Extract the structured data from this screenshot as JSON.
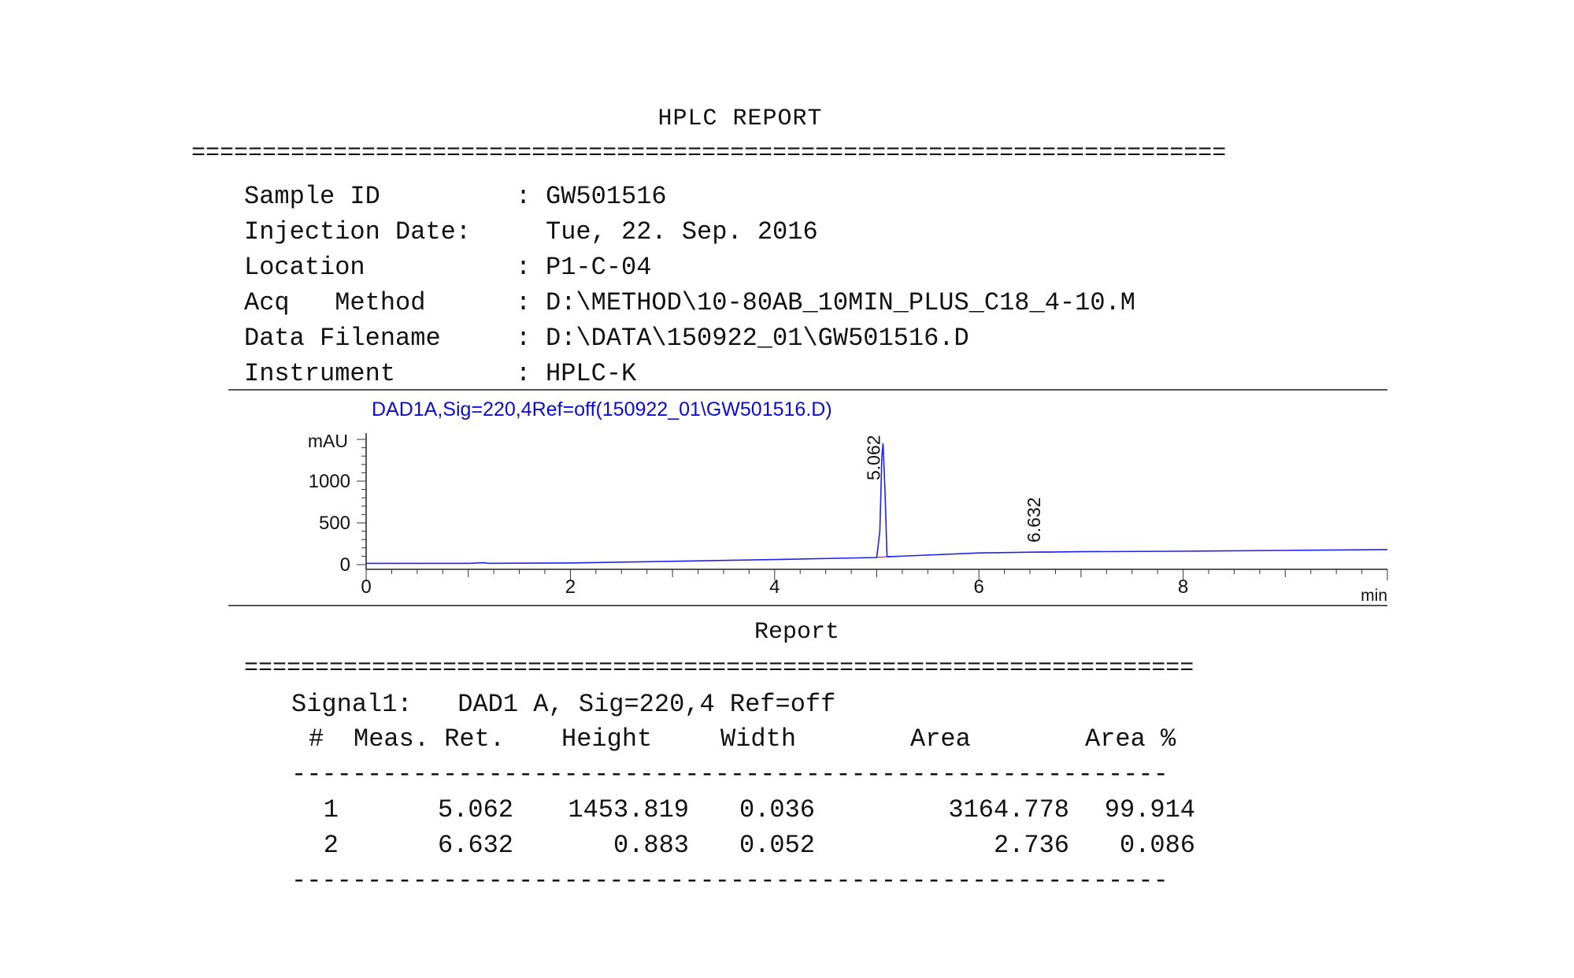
{
  "title": "HPLC REPORT",
  "rule_top": "=========================================================================",
  "meta": [
    {
      "label": "Sample ID",
      "colon": ":",
      "value": "GW501516"
    },
    {
      "label": "Injection Date:",
      "colon": "",
      "value": "Tue, 22. Sep. 2016"
    },
    {
      "label": "Location",
      "colon": ":",
      "value": "P1-C-04"
    },
    {
      "label": "Acq   Method",
      "colon": ":",
      "value": "D:\\METHOD\\10-80AB_10MIN_PLUS_C18_4-10.M"
    },
    {
      "label": "Data Filename",
      "colon": ":",
      "value": "D:\\DATA\\150922_01\\GW501516.D"
    },
    {
      "label": "Instrument",
      "colon": ":",
      "value": "HPLC-K"
    }
  ],
  "chart_data": {
    "type": "line",
    "title": "DAD1A,Sig=220,4Ref=off(150922_01\\GW501516.D)",
    "ylabel": "mAU",
    "xlabel": "min",
    "xlim": [
      0,
      10
    ],
    "ylim": [
      0,
      1500
    ],
    "x_ticks": [
      "0",
      "2",
      "4",
      "6",
      "8"
    ],
    "x_tick_values": [
      0,
      2,
      4,
      6,
      8
    ],
    "y_ticks": [
      "0",
      "500",
      "1000"
    ],
    "y_tick_values": [
      0,
      500,
      1000
    ],
    "line_color": "#2222ee",
    "baseline_color": "#e0407a",
    "series": [
      {
        "x": [
          0,
          1,
          1.15,
          1.2,
          2,
          3,
          4,
          4.8,
          5.0,
          5.03,
          5.05,
          5.062,
          5.08,
          5.1,
          5.13,
          6,
          6.6,
          6.632,
          6.7,
          7,
          8,
          9,
          10
        ],
        "y": [
          15,
          15,
          22,
          15,
          20,
          40,
          60,
          80,
          85,
          400,
          1300,
          1453,
          900,
          100,
          95,
          140,
          150,
          151,
          150,
          155,
          160,
          170,
          180
        ]
      }
    ],
    "peaks": [
      {
        "rt": 5.062,
        "label": "5.062",
        "y": 1453
      },
      {
        "rt": 6.632,
        "label": "6.632",
        "y": 151
      }
    ]
  },
  "report_title": "Report",
  "rule_report": "===================================================================",
  "signal": "Signal1:   DAD1 A, Sig=220,4 Ref=off",
  "table": {
    "headers": [
      "#",
      "Meas. Ret.",
      "Height",
      "Width",
      "Area",
      "Area %"
    ],
    "divider": "----------------------------------------------------------",
    "rows": [
      [
        "1",
        "5.062",
        "1453.819",
        "0.036",
        "3164.778",
        "99.914"
      ],
      [
        "2",
        "6.632",
        "0.883",
        "0.052",
        "2.736",
        "0.086"
      ]
    ]
  }
}
